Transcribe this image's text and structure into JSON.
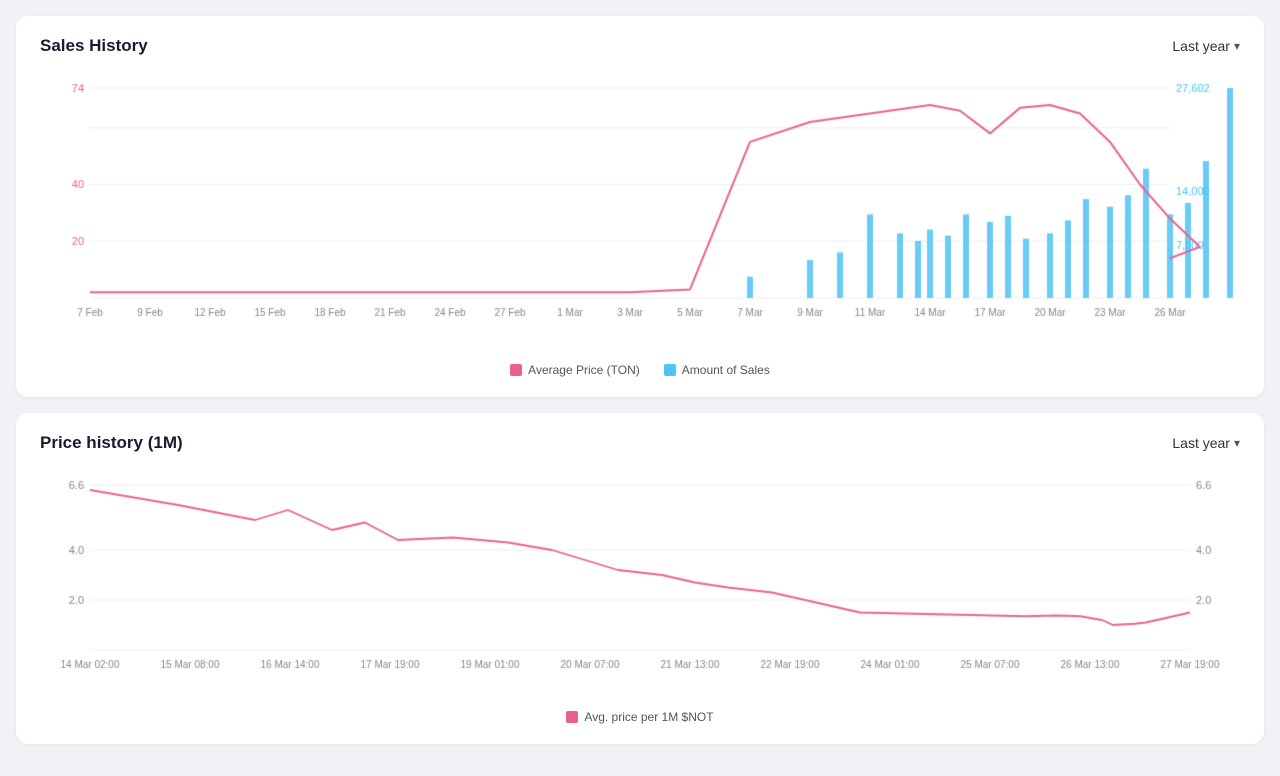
{
  "salesHistory": {
    "title": "Sales History",
    "period": "Last year",
    "leftAxis": [
      74,
      40,
      20
    ],
    "rightAxis": [
      27602,
      14000,
      7000
    ],
    "xLabels": [
      "7 Feb",
      "9 Feb",
      "12 Feb",
      "15 Feb",
      "18 Feb",
      "21 Feb",
      "24 Feb",
      "27 Feb",
      "1 Mar",
      "3 Mar",
      "5 Mar",
      "7 Mar",
      "9 Mar",
      "11 Mar",
      "14 Mar",
      "17 Mar",
      "20 Mar",
      "23 Mar",
      "26 Mar"
    ],
    "legend": {
      "line": "Average Price (TON)",
      "bar": "Amount of Sales"
    },
    "lineColor": "#e8638c",
    "barColor": "#4fc3f7"
  },
  "priceHistory": {
    "title": "Price history (1M)",
    "period": "Last year",
    "leftAxis": [
      6.6,
      4.0,
      2.0
    ],
    "rightAxis": [
      6.6,
      4.0,
      2.0
    ],
    "xLabels": [
      "14 Mar 02:00",
      "15 Mar 08:00",
      "16 Mar 14:00",
      "17 Mar 19:00",
      "19 Mar 01:00",
      "20 Mar 07:00",
      "21 Mar 13:00",
      "22 Mar 19:00",
      "24 Mar 01:00",
      "25 Mar 07:00",
      "26 Mar 13:00",
      "27 Mar 19:00"
    ],
    "legend": {
      "line": "Avg. price per 1M $NOT"
    },
    "lineColor": "#e8638c"
  }
}
